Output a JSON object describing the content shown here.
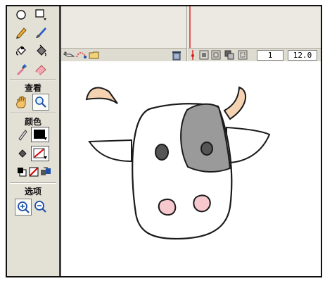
{
  "toolbox": {
    "view_label": "查看",
    "color_label": "颜色",
    "options_label": "选项",
    "icons": [
      "oval-tool-icon",
      "rectangle-tool-icon",
      "pencil-tool-icon",
      "brush-tool-icon",
      "ink-bottle-tool-icon",
      "paint-bucket-tool-icon",
      "eyedropper-tool-icon",
      "eraser-tool-icon",
      "hand-tool-icon",
      "zoom-tool-icon",
      "stroke-color-icon",
      "fill-color-icon",
      "black-and-white-icon",
      "no-color-icon",
      "swap-colors-icon",
      "zoom-in-icon",
      "zoom-out-icon"
    ]
  },
  "timeline": {
    "current_frame": "1",
    "frame_rate": "12.0",
    "playhead_color": "#d81c1c"
  },
  "colors": {
    "toolbox_bg": "#e3e0d6",
    "stroke_color": "#000000",
    "horn_fill": "#f5d3b2",
    "spot_fill": "#9a9a9a",
    "nostril_fill": "#f7c9cf"
  }
}
